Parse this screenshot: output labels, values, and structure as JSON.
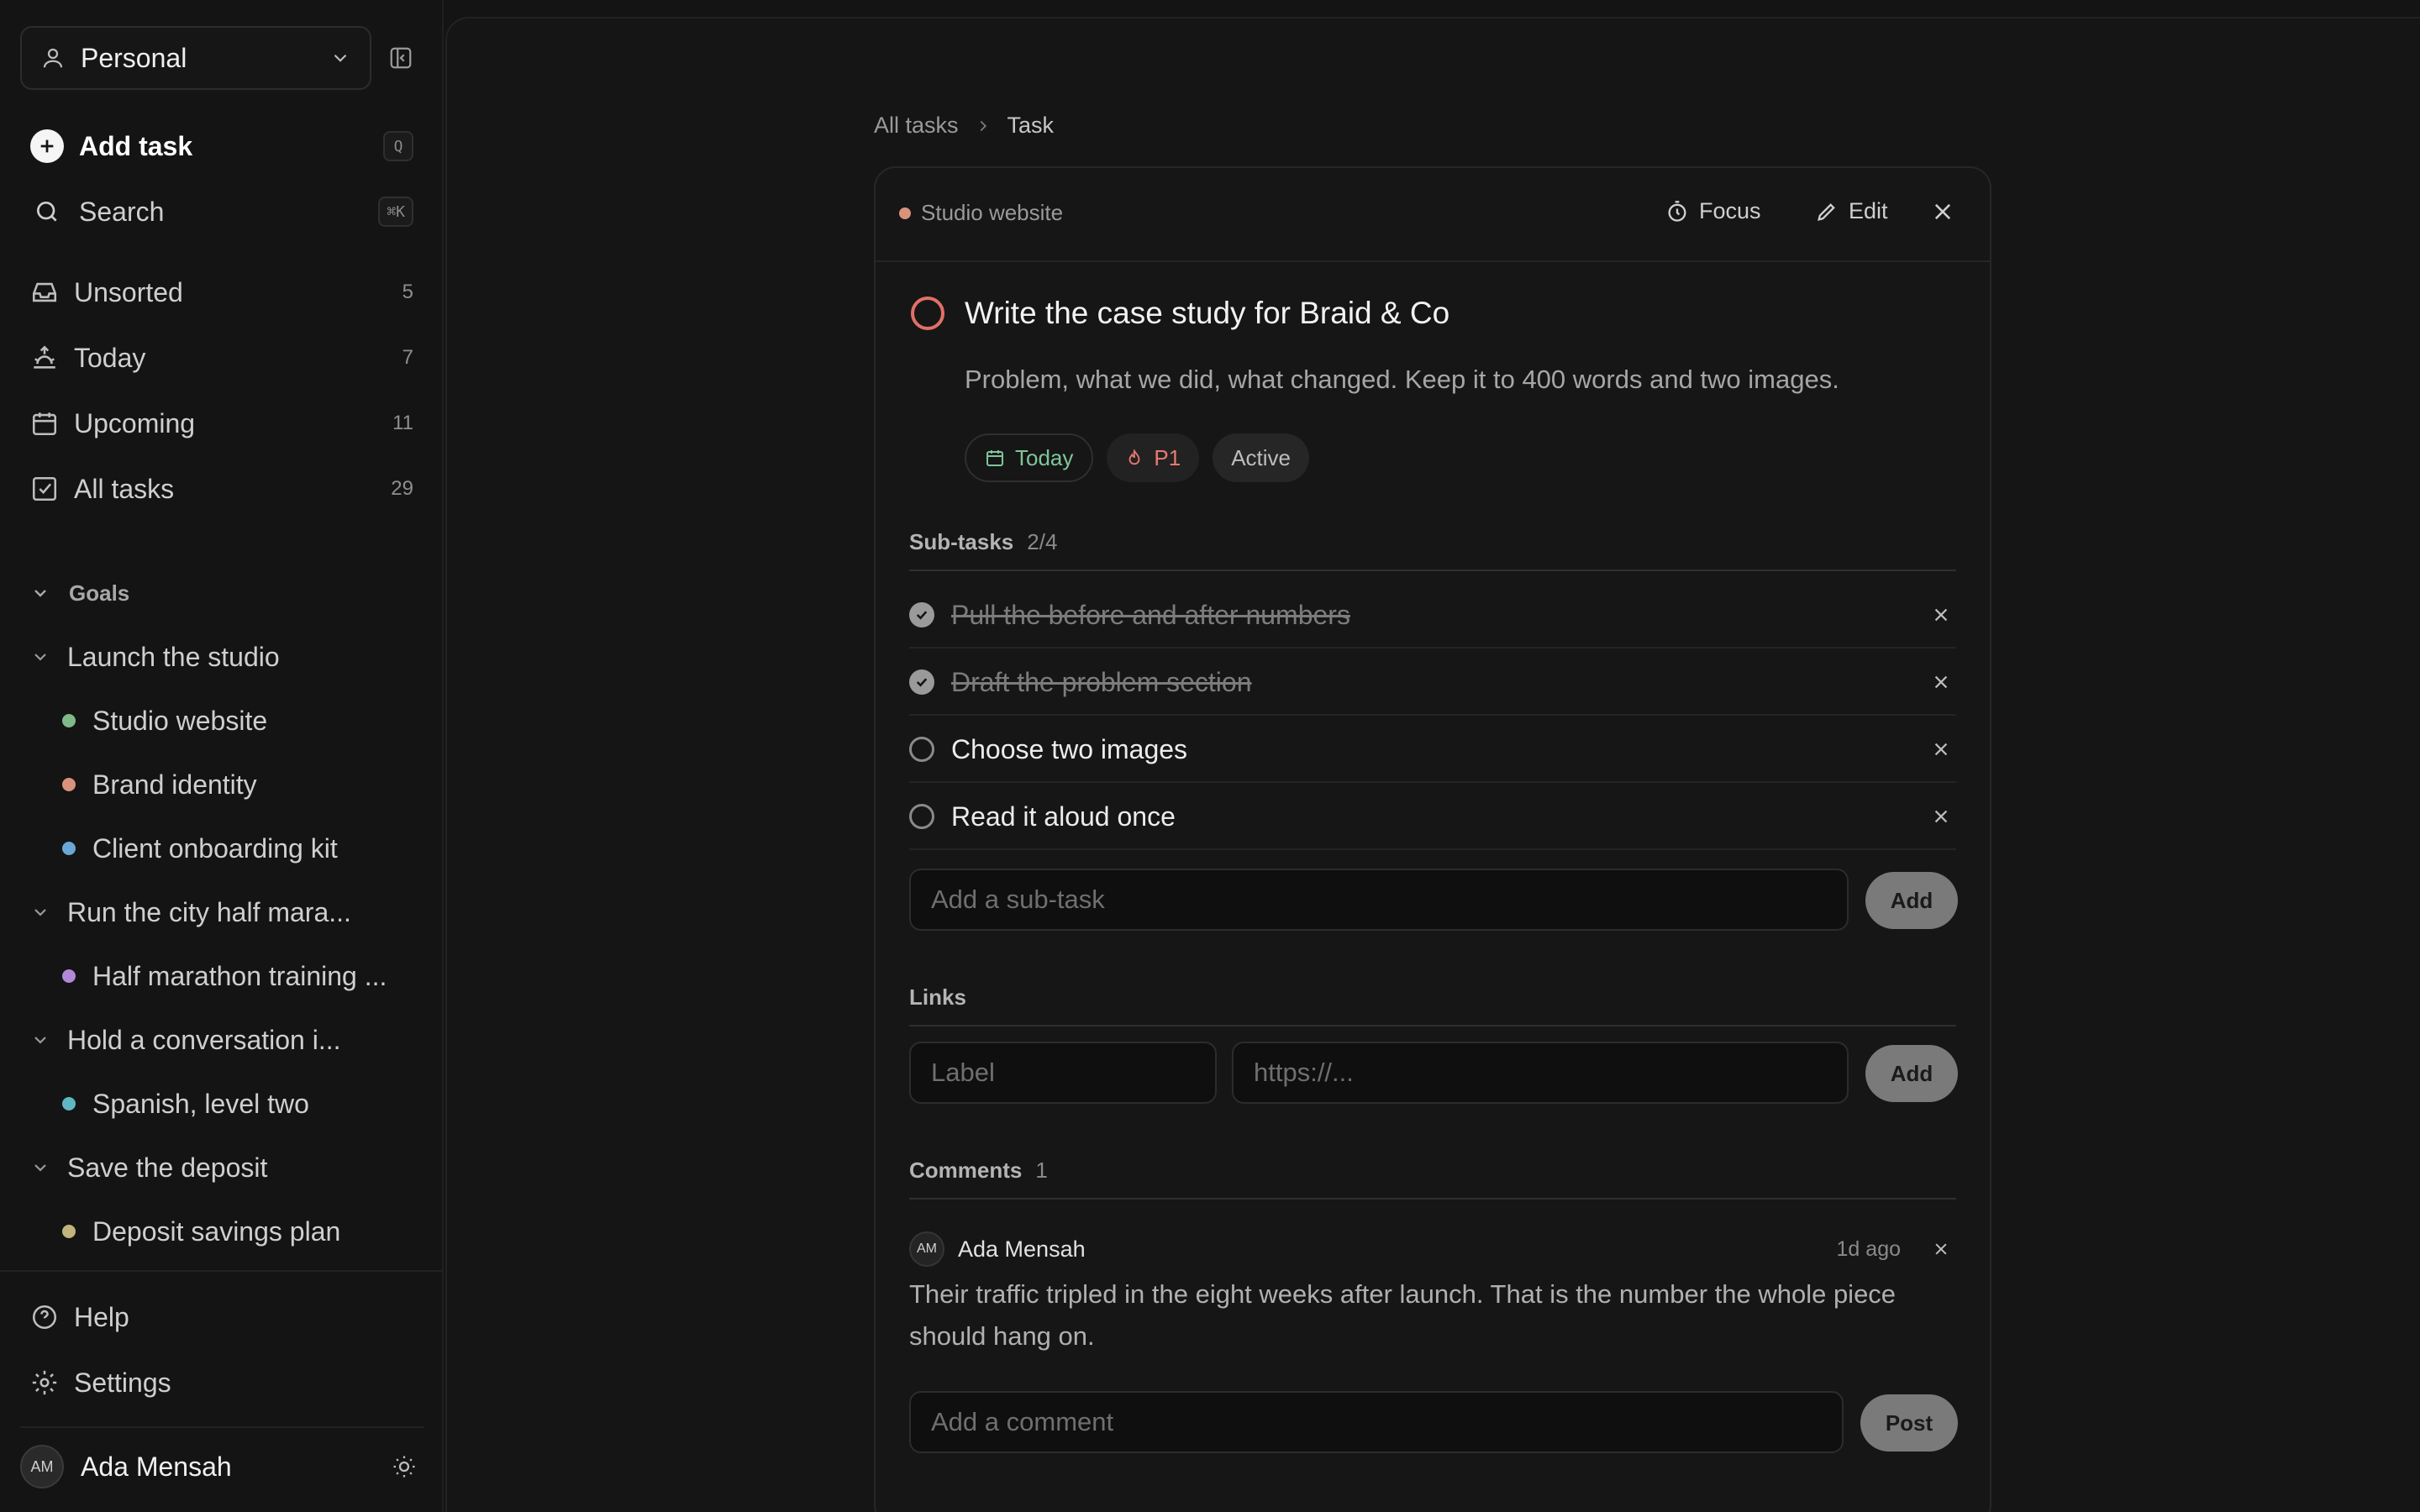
{
  "sidebar": {
    "workspace_label": "Personal",
    "add_task": {
      "label": "Add task",
      "shortcut": "Q"
    },
    "search": {
      "label": "Search",
      "shortcut": "⌘K"
    },
    "nav": [
      {
        "label": "Unsorted",
        "count": "5",
        "icon": "inbox-icon"
      },
      {
        "label": "Today",
        "count": "7",
        "icon": "sunrise-icon"
      },
      {
        "label": "Upcoming",
        "count": "11",
        "icon": "calendar-icon"
      },
      {
        "label": "All tasks",
        "count": "29",
        "icon": "checkbox-icon"
      }
    ],
    "goals_heading": "Goals",
    "goals": [
      {
        "label": "Launch the studio",
        "projects": [
          {
            "label": "Studio website",
            "color": "#7fb98a"
          },
          {
            "label": "Brand identity",
            "color": "#d9937c"
          },
          {
            "label": "Client onboarding kit",
            "color": "#6aa7d6"
          }
        ]
      },
      {
        "label": "Run the city half mara...",
        "projects": [
          {
            "label": "Half marathon training ...",
            "color": "#b08ad8"
          }
        ]
      },
      {
        "label": "Hold a conversation i...",
        "projects": [
          {
            "label": "Spanish, level two",
            "color": "#5fb7c2"
          }
        ]
      },
      {
        "label": "Save the deposit",
        "projects": [
          {
            "label": "Deposit savings plan",
            "color": "#c2b57a"
          }
        ]
      }
    ],
    "help": "Help",
    "settings": "Settings",
    "user": {
      "name": "Ada Mensah",
      "initials": "AM"
    }
  },
  "breadcrumb": {
    "root": "All tasks",
    "current": "Task"
  },
  "task": {
    "project": {
      "label": "Studio website",
      "color": "#d9937c"
    },
    "focus_label": "Focus",
    "edit_label": "Edit",
    "title": "Write the case study for Braid & Co",
    "description": "Problem, what we did, what changed. Keep it to 400 words and two images.",
    "tags": {
      "due": "Today",
      "priority": "P1",
      "status": "Active"
    },
    "subtasks": {
      "heading": "Sub-tasks",
      "progress": "2/4",
      "items": [
        {
          "label": "Pull the before and after numbers",
          "done": true
        },
        {
          "label": "Draft the problem section",
          "done": true
        },
        {
          "label": "Choose two images",
          "done": false
        },
        {
          "label": "Read it aloud once",
          "done": false
        }
      ],
      "input_placeholder": "Add a sub-task",
      "add_label": "Add"
    },
    "links": {
      "heading": "Links",
      "label_placeholder": "Label",
      "url_placeholder": "https://...",
      "add_label": "Add"
    },
    "comments": {
      "heading": "Comments",
      "count": "1",
      "items": [
        {
          "author": "Ada Mensah",
          "initials": "AM",
          "time": "1d ago",
          "body": "Their traffic tripled in the eight weeks after launch. That is the number the whole piece should hang on."
        }
      ],
      "input_placeholder": "Add a comment",
      "post_label": "Post"
    }
  }
}
